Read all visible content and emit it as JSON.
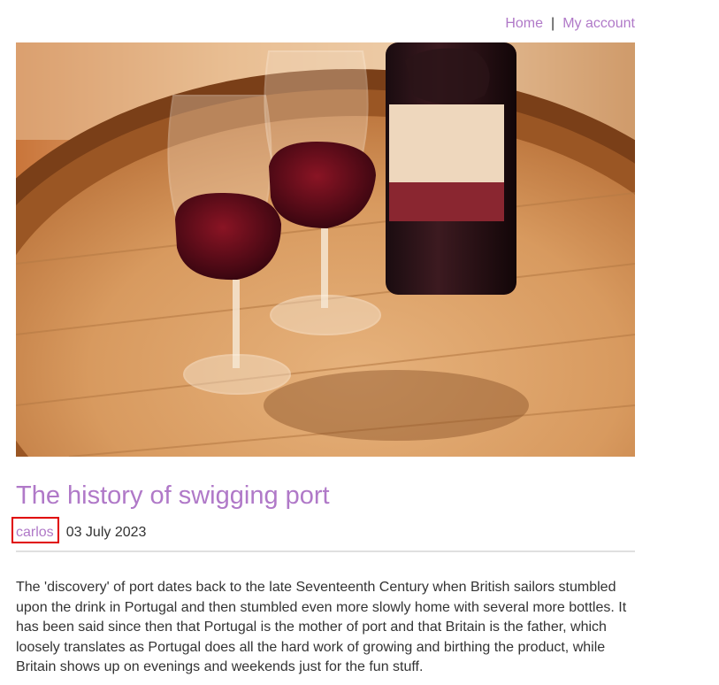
{
  "nav": {
    "home_label": "Home",
    "separator": "|",
    "account_label": "My account"
  },
  "post": {
    "image_subject": "two glasses of red port wine and a bottle on a wooden barrel",
    "title": "The history of swigging port",
    "author": "carlos",
    "date": "03 July 2023",
    "body": "The 'discovery' of port dates back to the late Seventeenth Century when British sailors stumbled upon the drink in Portugal and then stumbled even more slowly home with several more bottles. It has been said since then that Portugal is the mother of port and that Britain is the father, which loosely translates as Portugal does all the hard work of growing and birthing the product, while Britain shows up on evenings and weekends just for the fun stuff."
  },
  "colors": {
    "link": "#b079c8",
    "text": "#333333",
    "highlight_box": "#e00000",
    "divider": "#e0e0e0"
  }
}
